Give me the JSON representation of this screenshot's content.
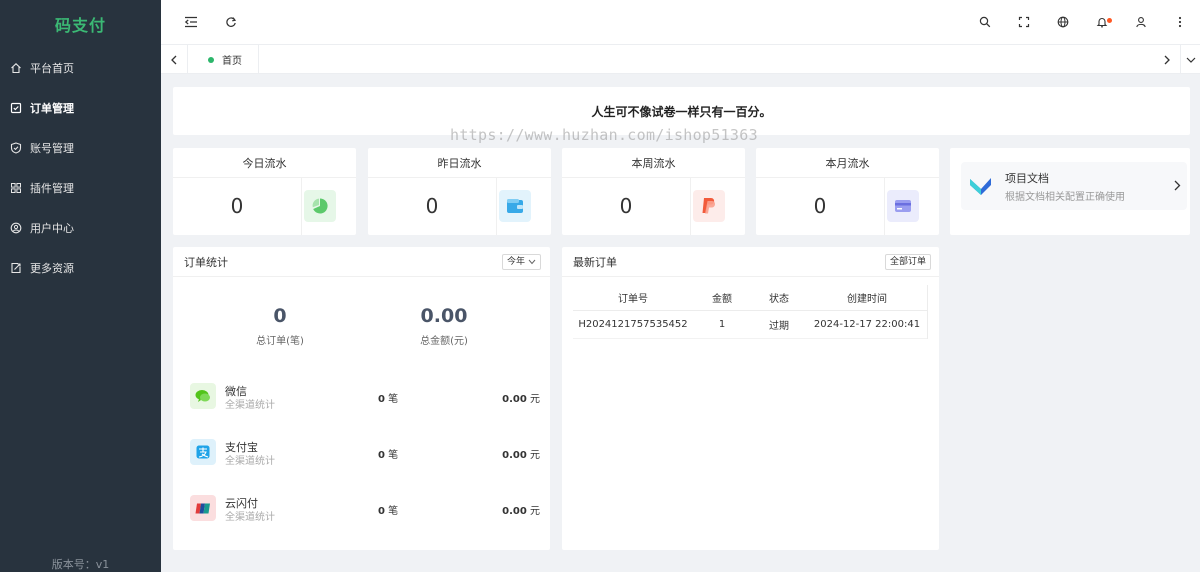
{
  "app": {
    "name": "码支付",
    "version": "版本号：v1"
  },
  "sidebar": {
    "items": [
      {
        "label": "平台首页",
        "icon": "home-icon"
      },
      {
        "label": "订单管理",
        "icon": "order-icon"
      },
      {
        "label": "账号管理",
        "icon": "shield-icon"
      },
      {
        "label": "插件管理",
        "icon": "grid-icon"
      },
      {
        "label": "用户中心",
        "icon": "user-circle-icon"
      },
      {
        "label": "更多资源",
        "icon": "export-icon"
      }
    ]
  },
  "tabs": {
    "home": "首页"
  },
  "motto": "人生可不像试卷一样只有一百分。",
  "watermark": "https://www.huzhan.com/ishop51363",
  "stats": [
    {
      "title": "今日流水",
      "value": "0",
      "icon": "pie-chart-icon",
      "color": "#5cc96b",
      "bg": "#e6f7e8"
    },
    {
      "title": "昨日流水",
      "value": "0",
      "icon": "wallet-icon",
      "color": "#37a9e8",
      "bg": "#e2f3fc"
    },
    {
      "title": "本周流水",
      "value": "0",
      "icon": "paypal-icon",
      "color": "#f25a3b",
      "bg": "#fdecea"
    },
    {
      "title": "本月流水",
      "value": "0",
      "icon": "card-icon",
      "color": "#7c80e8",
      "bg": "#ebecfc"
    }
  ],
  "doc": {
    "title": "项目文档",
    "subtitle": "根据文档相关配置正确使用"
  },
  "orders": {
    "title": "订单统计",
    "range": "今年",
    "total_orders": "0",
    "total_orders_label": "总订单(笔)",
    "total_amount": "0.00",
    "total_amount_label": "总金额(元)",
    "channels": [
      {
        "name": "微信",
        "sub": "全渠道统计",
        "count": "0",
        "count_unit": "笔",
        "amount": "0.00",
        "amount_unit": "元",
        "icon": "wechat-icon",
        "color": "#52c41a",
        "bg": "#e8f7e2"
      },
      {
        "name": "支付宝",
        "sub": "全渠道统计",
        "count": "0",
        "count_unit": "笔",
        "amount": "0.00",
        "amount_unit": "元",
        "icon": "alipay-icon",
        "color": "#1fa3e8",
        "bg": "#def1fb"
      },
      {
        "name": "云闪付",
        "sub": "全渠道统计",
        "count": "0",
        "count_unit": "笔",
        "amount": "0.00",
        "amount_unit": "元",
        "icon": "unionpay-icon",
        "color": "#e23b3b",
        "bg": "#fbdedf"
      }
    ]
  },
  "latest": {
    "title": "最新订单",
    "all_button": "全部订单",
    "columns": [
      "订单号",
      "金额",
      "状态",
      "创建时间"
    ],
    "rows": [
      [
        "H2024121757535452",
        "1",
        "过期",
        "2024-12-17 22:00:41"
      ]
    ]
  }
}
